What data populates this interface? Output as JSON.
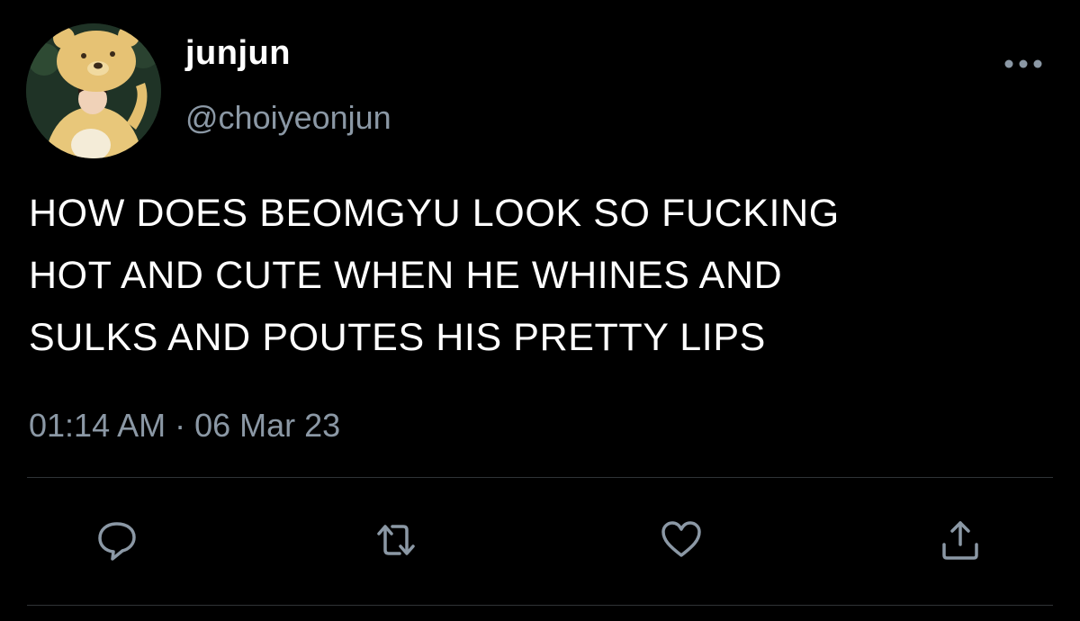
{
  "tweet": {
    "author": {
      "display_name": "junjun",
      "handle": "@choiyeonjun",
      "avatar_icon": "avatar-bear-costume"
    },
    "text_lines": [
      "HOW DOES BEOMGYU LOOK SO FUCKING",
      "HOT AND CUTE WHEN HE WHINES AND",
      "SULKS AND POUTES HIS PRETTY LIPS"
    ],
    "timestamp": "01:14 AM · 06 Mar 23"
  },
  "actions": [
    {
      "icon": "reply-icon"
    },
    {
      "icon": "retweet-icon"
    },
    {
      "icon": "like-icon"
    },
    {
      "icon": "share-icon"
    }
  ],
  "colors": {
    "background": "#000000",
    "primary_text": "#ffffff",
    "secondary_text": "#8b98a5",
    "divider": "#2f3336"
  }
}
